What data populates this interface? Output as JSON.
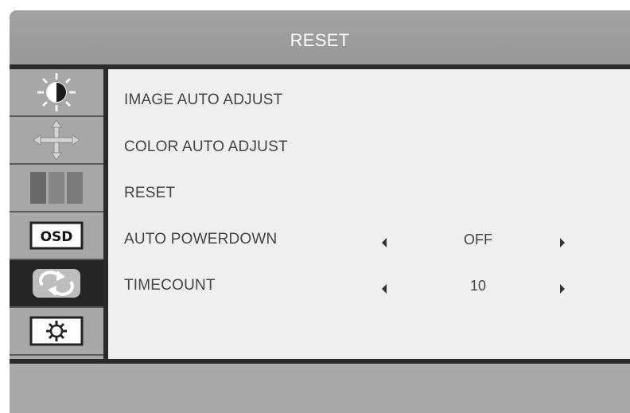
{
  "header": {
    "title": "RESET"
  },
  "sidebar": {
    "tabs": [
      {
        "icon": "brightness-contrast-icon",
        "active": false
      },
      {
        "icon": "position-arrows-icon",
        "active": false
      },
      {
        "icon": "color-bars-icon",
        "active": false
      },
      {
        "icon": "osd-icon",
        "label": "OSD",
        "active": false
      },
      {
        "icon": "reset-arrows-icon",
        "active": true
      },
      {
        "icon": "settings-gear-icon",
        "active": false
      }
    ]
  },
  "menu": {
    "items": [
      {
        "label": "IMAGE AUTO ADJUST"
      },
      {
        "label": "COLOR AUTO ADJUST"
      },
      {
        "label": "RESET"
      },
      {
        "label": "AUTO POWERDOWN",
        "value": "OFF"
      },
      {
        "label": "TIMECOUNT",
        "value": "10"
      }
    ]
  },
  "colors": {
    "frame": "#a9a9a9",
    "content": "#efefef",
    "divider": "#2b2b2b",
    "active_tab": "#252525",
    "text": "#444444",
    "title_text": "#ffffff"
  }
}
